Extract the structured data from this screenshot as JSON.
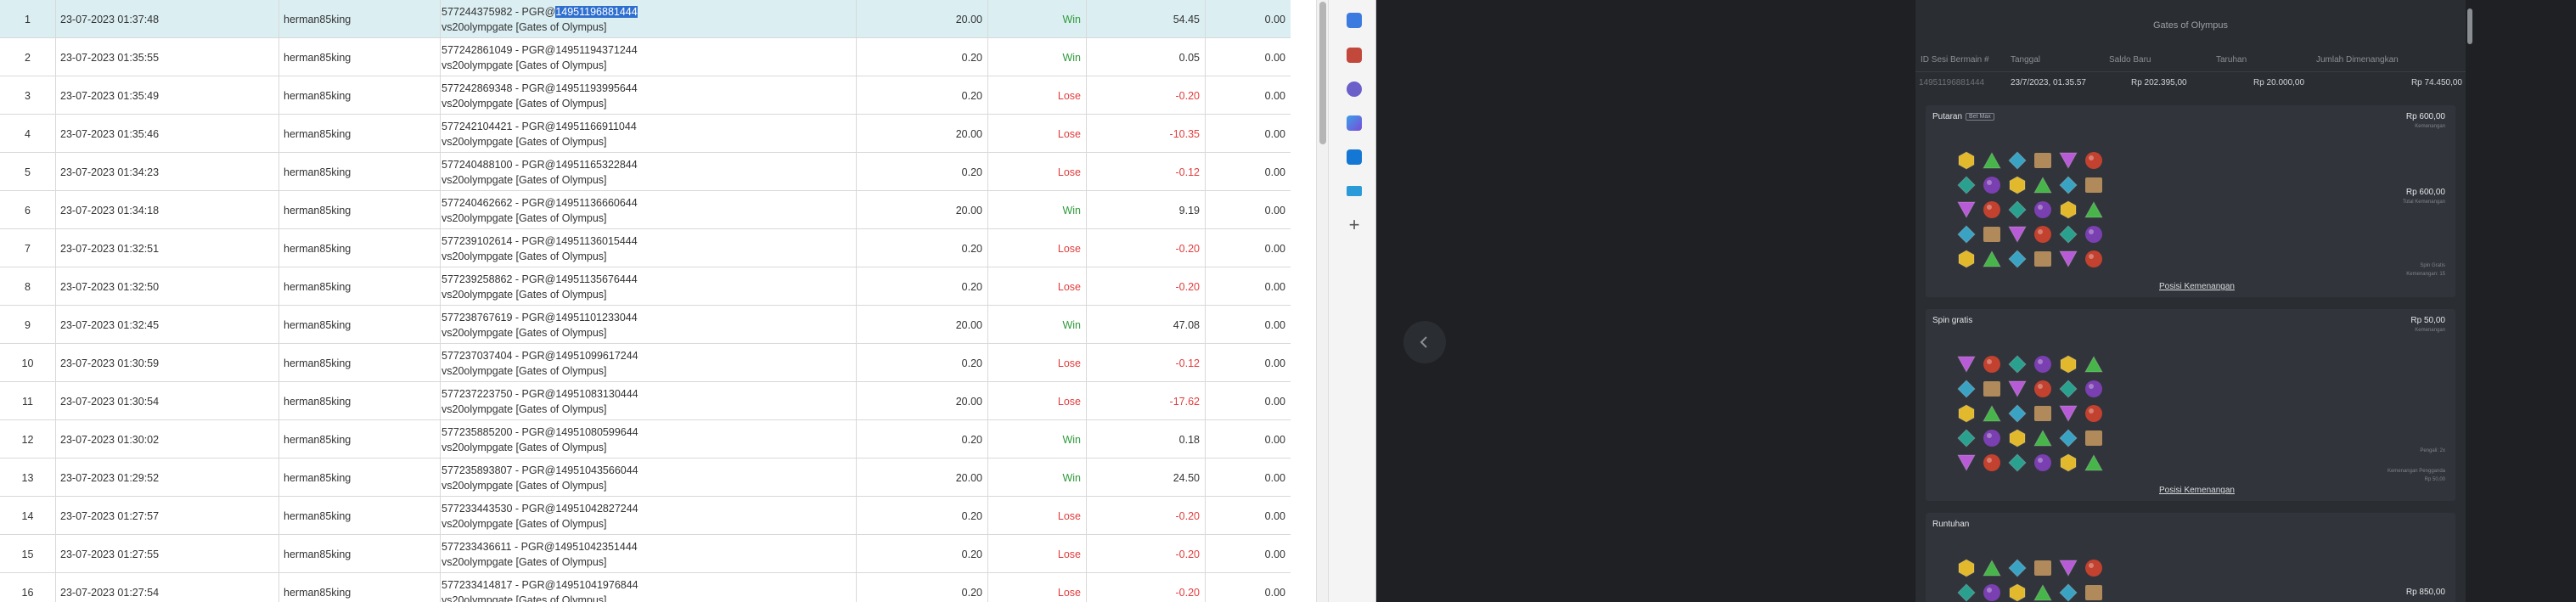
{
  "table": {
    "rows": [
      {
        "no": "1",
        "date": "23-07-2023 01:37:48",
        "user": "herman85king",
        "trans_prefix": "577244375982 - PGR@",
        "trans_id": "14951196881444",
        "trans_line2": "vs20olympgate [Gates of Olympus]",
        "bet": "20.00",
        "status": "Win",
        "amount": "54.45",
        "extra": "0.00",
        "selected": true
      },
      {
        "no": "2",
        "date": "23-07-2023 01:35:55",
        "user": "herman85king",
        "trans_prefix": "577242861049 - PGR@",
        "trans_id": "14951194371244",
        "trans_line2": "vs20olympgate [Gates of Olympus]",
        "bet": "0.20",
        "status": "Win",
        "amount": "0.05",
        "extra": "0.00"
      },
      {
        "no": "3",
        "date": "23-07-2023 01:35:49",
        "user": "herman85king",
        "trans_prefix": "577242869348 - PGR@",
        "trans_id": "14951193995644",
        "trans_line2": "vs20olympgate [Gates of Olympus]",
        "bet": "0.20",
        "status": "Lose",
        "amount": "-0.20",
        "extra": "0.00"
      },
      {
        "no": "4",
        "date": "23-07-2023 01:35:46",
        "user": "herman85king",
        "trans_prefix": "577242104421 - PGR@",
        "trans_id": "14951166911044",
        "trans_line2": "vs20olympgate [Gates of Olympus]",
        "bet": "20.00",
        "status": "Lose",
        "amount": "-10.35",
        "extra": "0.00"
      },
      {
        "no": "5",
        "date": "23-07-2023 01:34:23",
        "user": "herman85king",
        "trans_prefix": "577240488100 - PGR@",
        "trans_id": "14951165322844",
        "trans_line2": "vs20olympgate [Gates of Olympus]",
        "bet": "0.20",
        "status": "Lose",
        "amount": "-0.12",
        "extra": "0.00"
      },
      {
        "no": "6",
        "date": "23-07-2023 01:34:18",
        "user": "herman85king",
        "trans_prefix": "577240462662 - PGR@",
        "trans_id": "14951136660644",
        "trans_line2": "vs20olympgate [Gates of Olympus]",
        "bet": "20.00",
        "status": "Win",
        "amount": "9.19",
        "extra": "0.00"
      },
      {
        "no": "7",
        "date": "23-07-2023 01:32:51",
        "user": "herman85king",
        "trans_prefix": "577239102614 - PGR@",
        "trans_id": "14951136015444",
        "trans_line2": "vs20olympgate [Gates of Olympus]",
        "bet": "0.20",
        "status": "Lose",
        "amount": "-0.20",
        "extra": "0.00"
      },
      {
        "no": "8",
        "date": "23-07-2023 01:32:50",
        "user": "herman85king",
        "trans_prefix": "577239258862 - PGR@",
        "trans_id": "14951135676444",
        "trans_line2": "vs20olympgate [Gates of Olympus]",
        "bet": "0.20",
        "status": "Lose",
        "amount": "-0.20",
        "extra": "0.00"
      },
      {
        "no": "9",
        "date": "23-07-2023 01:32:45",
        "user": "herman85king",
        "trans_prefix": "577238767619 - PGR@",
        "trans_id": "14951101233044",
        "trans_line2": "vs20olympgate [Gates of Olympus]",
        "bet": "20.00",
        "status": "Win",
        "amount": "47.08",
        "extra": "0.00"
      },
      {
        "no": "10",
        "date": "23-07-2023 01:30:59",
        "user": "herman85king",
        "trans_prefix": "577237037404 - PGR@",
        "trans_id": "14951099617244",
        "trans_line2": "vs20olympgate [Gates of Olympus]",
        "bet": "0.20",
        "status": "Lose",
        "amount": "-0.12",
        "extra": "0.00"
      },
      {
        "no": "11",
        "date": "23-07-2023 01:30:54",
        "user": "herman85king",
        "trans_prefix": "577237223750 - PGR@",
        "trans_id": "14951083130444",
        "trans_line2": "vs20olympgate [Gates of Olympus]",
        "bet": "20.00",
        "status": "Lose",
        "amount": "-17.62",
        "extra": "0.00"
      },
      {
        "no": "12",
        "date": "23-07-2023 01:30:02",
        "user": "herman85king",
        "trans_prefix": "577235885200 - PGR@",
        "trans_id": "14951080599644",
        "trans_line2": "vs20olympgate [Gates of Olympus]",
        "bet": "0.20",
        "status": "Win",
        "amount": "0.18",
        "extra": "0.00"
      },
      {
        "no": "13",
        "date": "23-07-2023 01:29:52",
        "user": "herman85king",
        "trans_prefix": "577235893807 - PGR@",
        "trans_id": "14951043566044",
        "trans_line2": "vs20olympgate [Gates of Olympus]",
        "bet": "20.00",
        "status": "Win",
        "amount": "24.50",
        "extra": "0.00"
      },
      {
        "no": "14",
        "date": "23-07-2023 01:27:57",
        "user": "herman85king",
        "trans_prefix": "577233443530 - PGR@",
        "trans_id": "14951042827244",
        "trans_line2": "vs20olympgate [Gates of Olympus]",
        "bet": "0.20",
        "status": "Lose",
        "amount": "-0.20",
        "extra": "0.00"
      },
      {
        "no": "15",
        "date": "23-07-2023 01:27:55",
        "user": "herman85king",
        "trans_prefix": "577233436611 - PGR@",
        "trans_id": "14951042351444",
        "trans_line2": "vs20olympgate [Gates of Olympus]",
        "bet": "0.20",
        "status": "Lose",
        "amount": "-0.20",
        "extra": "0.00"
      },
      {
        "no": "16",
        "date": "23-07-2023 01:27:54",
        "user": "herman85king",
        "trans_prefix": "577233414817 - PGR@",
        "trans_id": "14951041976844",
        "trans_line2": "vs20olympgate [Gates of Olympus]",
        "bet": "0.20",
        "status": "Lose",
        "amount": "-0.20",
        "extra": "0.00"
      }
    ]
  },
  "browser_sidebar": {
    "icons": [
      "tag-icon",
      "wallet-icon",
      "people-icon",
      "m365-icon",
      "outlook-icon",
      "shopping-icon",
      "plus-icon"
    ]
  },
  "game_history": {
    "title": "Gates of Olympus",
    "headers": {
      "round_id": "ID Sesi Bermain #",
      "date": "Tanggal",
      "new_balance": "Saldo Baru",
      "bet": "Taruhan",
      "total_win": "Jumlah Dimenangkan"
    },
    "values": {
      "round_id": "14951196881444",
      "date": "23/7/2023, 01.35.57",
      "new_balance": "Rp 202.395,00",
      "bet": "Rp 20.000,00",
      "total_win": "Rp 74.450,00"
    },
    "spin": {
      "title": "Putaran",
      "pill": "Bet Max",
      "amount": "Rp 600,00",
      "amount_sub": "Kemenangan",
      "total": "Rp 600,00",
      "total_sub": "Total Kemenangan",
      "note1": "Spin Gratis",
      "note2": "Kemenangan: 15",
      "link": "Posisi Kemenangan"
    },
    "free_spins": {
      "title": "Spin gratis",
      "amount": "Rp 50,00",
      "amount_sub": "Kemenangan",
      "note1": "Pengali: 2x",
      "note2": "Kemenangan Pengganda",
      "note3": "Rp 50,00",
      "link": "Posisi Kemenangan"
    },
    "tumble": {
      "title": "Runtuhan",
      "amount": "Rp 850,00"
    }
  },
  "colors": {
    "win": "#2e9c3a",
    "lose": "#e23c3c",
    "selected_row": "#dbeef2",
    "highlight": "#2f6fd0"
  }
}
